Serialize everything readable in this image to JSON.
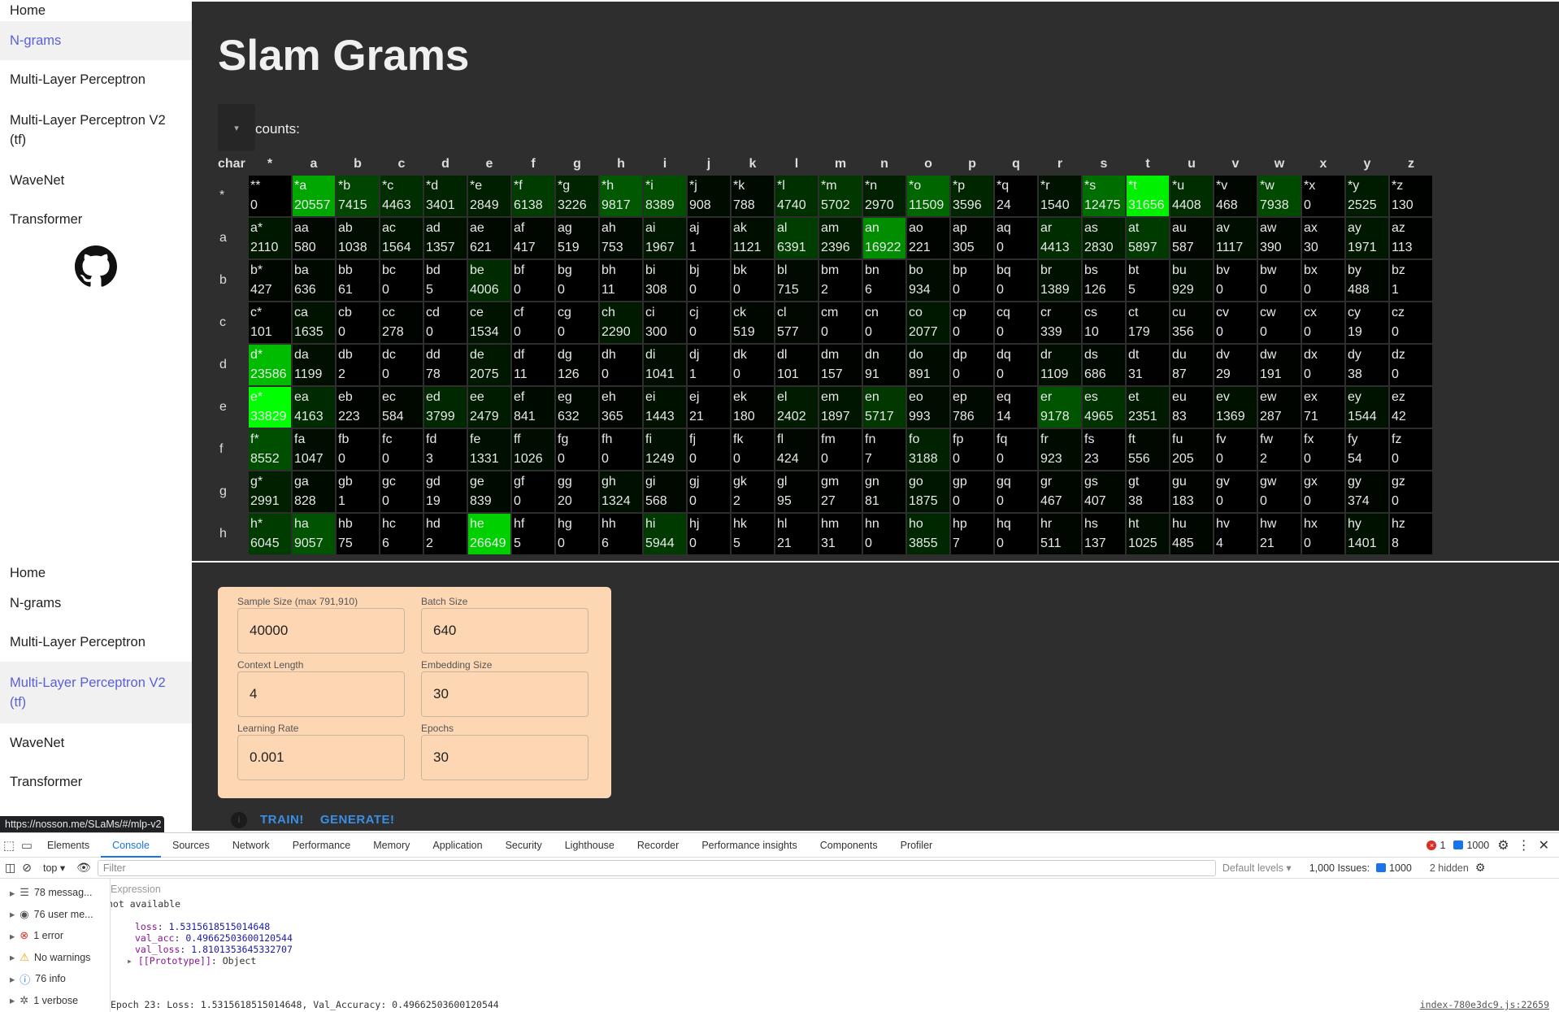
{
  "nav": {
    "items": [
      "Home",
      "N-grams",
      "Multi-Layer Perceptron",
      "Multi-Layer Perceptron V2 (tf)",
      "WaveNet",
      "Transformer"
    ],
    "active_top": 1,
    "active_bottom": 3
  },
  "page": {
    "title": "Slam Grams",
    "counts_label": "counts:",
    "corner_label": "char"
  },
  "chart_data": {
    "type": "heatmap",
    "columns": [
      "*",
      "a",
      "b",
      "c",
      "d",
      "e",
      "f",
      "g",
      "h",
      "i",
      "j",
      "k",
      "l",
      "m",
      "n",
      "o",
      "p",
      "q",
      "r",
      "s",
      "t",
      "u",
      "v",
      "w",
      "x",
      "y",
      "z"
    ],
    "rows": [
      {
        "label": "*",
        "prefix": "*",
        "values": [
          0,
          20557,
          7415,
          4463,
          3401,
          2849,
          6138,
          3226,
          9817,
          8389,
          908,
          788,
          4740,
          5702,
          2970,
          11509,
          3596,
          24,
          1540,
          12475,
          31656,
          4408,
          468,
          7938,
          0,
          2525,
          130
        ]
      },
      {
        "label": "a",
        "prefix": "a",
        "values": [
          2110,
          580,
          1038,
          1564,
          1357,
          621,
          417,
          519,
          753,
          1967,
          1,
          1121,
          6391,
          2396,
          16922,
          221,
          305,
          0,
          4413,
          2830,
          5897,
          587,
          1117,
          390,
          30,
          1971,
          113
        ]
      },
      {
        "label": "b",
        "prefix": "b",
        "values": [
          427,
          636,
          61,
          0,
          5,
          4006,
          0,
          0,
          11,
          308,
          0,
          0,
          715,
          2,
          6,
          934,
          0,
          0,
          1389,
          126,
          5,
          929,
          0,
          0,
          0,
          488,
          1
        ]
      },
      {
        "label": "c",
        "prefix": "c",
        "values": [
          101,
          1635,
          0,
          278,
          0,
          1534,
          0,
          0,
          2290,
          300,
          0,
          519,
          577,
          0,
          0,
          2077,
          0,
          0,
          339,
          10,
          179,
          356,
          0,
          0,
          0,
          19,
          0
        ]
      },
      {
        "label": "d",
        "prefix": "d",
        "values": [
          23586,
          1199,
          2,
          0,
          78,
          2075,
          11,
          126,
          0,
          1041,
          1,
          0,
          101,
          157,
          91,
          891,
          0,
          0,
          1109,
          686,
          31,
          87,
          29,
          191,
          0,
          38,
          0
        ]
      },
      {
        "label": "e",
        "prefix": "e",
        "values": [
          33829,
          4163,
          223,
          584,
          3799,
          2479,
          841,
          632,
          365,
          1443,
          21,
          180,
          2402,
          1897,
          5717,
          993,
          786,
          14,
          9178,
          4965,
          2351,
          83,
          1369,
          287,
          71,
          1544,
          42
        ]
      },
      {
        "label": "f",
        "prefix": "f",
        "values": [
          8552,
          1047,
          0,
          0,
          3,
          1331,
          1026,
          0,
          0,
          1249,
          0,
          0,
          424,
          0,
          7,
          3188,
          0,
          0,
          923,
          23,
          556,
          205,
          0,
          2,
          0,
          54,
          0
        ]
      },
      {
        "label": "g",
        "prefix": "g",
        "values": [
          2991,
          828,
          1,
          0,
          19,
          839,
          0,
          20,
          1324,
          568,
          0,
          2,
          95,
          27,
          81,
          1875,
          0,
          0,
          467,
          407,
          38,
          183,
          0,
          0,
          0,
          374,
          0
        ]
      },
      {
        "label": "h",
        "prefix": "h",
        "values": [
          6045,
          9057,
          75,
          6,
          2,
          26649,
          5,
          0,
          6,
          5944,
          0,
          5,
          21,
          31,
          0,
          3855,
          7,
          0,
          511,
          137,
          1025,
          485,
          4,
          21,
          0,
          1401,
          8
        ]
      }
    ],
    "max": 33829,
    "color": "#00ff00"
  },
  "form": {
    "fields": [
      {
        "label": "Sample Size (max 791,910)",
        "value": "40000"
      },
      {
        "label": "Batch Size",
        "value": "640"
      },
      {
        "label": "Context Length",
        "value": "4"
      },
      {
        "label": "Embedding Size",
        "value": "30"
      },
      {
        "label": "Learning Rate",
        "value": "0.001"
      },
      {
        "label": "Epochs",
        "value": "30"
      }
    ],
    "train_label": "TRAIN!",
    "generate_label": "GENERATE!"
  },
  "status_url": "https://nosson.me/SLaMs/#/mlp-v2",
  "devtools": {
    "tabs": [
      "Elements",
      "Console",
      "Sources",
      "Network",
      "Performance",
      "Memory",
      "Application",
      "Security",
      "Lighthouse",
      "Recorder",
      "Performance insights",
      "Components",
      "Profiler"
    ],
    "active_tab": "Console",
    "error_count": "1",
    "message_count": "1000",
    "context": "top",
    "filter_placeholder": "Filter",
    "levels": "Default levels",
    "issues_label": "1,000 Issues:",
    "issues_count": "1000",
    "hidden": "2 hidden",
    "sidebar": [
      "78 messag...",
      "76 user me...",
      "1 error",
      "No warnings",
      "76 info",
      "1 verbose"
    ],
    "expression_label": "Expression",
    "not_available": "not available",
    "log": [
      {
        "k": "loss",
        "v": "1.5315618515014648"
      },
      {
        "k": "val_acc",
        "v": "0.49662503600120544"
      },
      {
        "k": "val_loss",
        "v": "1.8101353645332707"
      },
      {
        "k": "[[Prototype]]",
        "v": "Object"
      }
    ],
    "epoch_line": "Epoch 23: Loss: 1.5315618515014648, Val_Accuracy: 0.49662503600120544",
    "source_link": "index-780e3dc9.js:22659"
  }
}
